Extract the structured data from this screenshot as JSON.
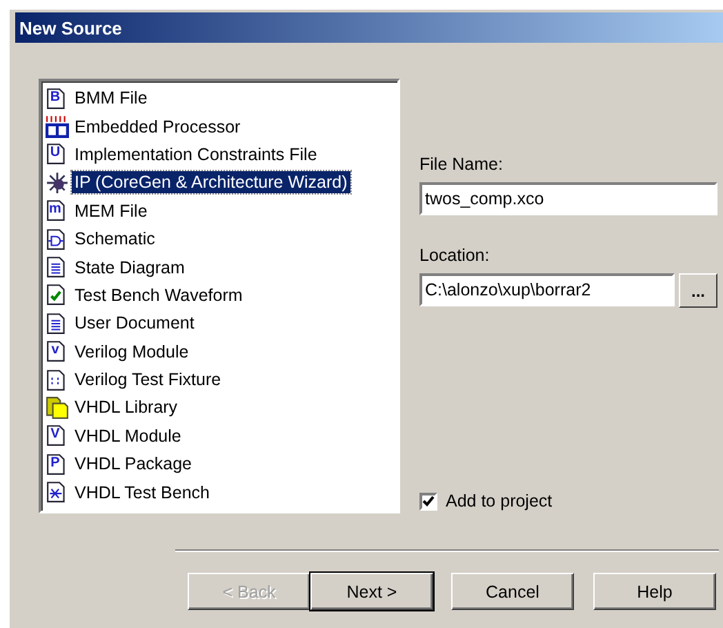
{
  "window": {
    "title": "New Source"
  },
  "source_types": [
    {
      "label": "BMM File",
      "kind": "letter-doc",
      "icon_text": "B",
      "selected": false
    },
    {
      "label": "Embedded Processor",
      "kind": "processor",
      "selected": false
    },
    {
      "label": "Implementation Constraints File",
      "kind": "letter-doc",
      "icon_text": "U",
      "selected": false
    },
    {
      "label": "IP (CoreGen & Architecture Wizard)",
      "kind": "wizard",
      "selected": true
    },
    {
      "label": "MEM File",
      "kind": "letter-doc",
      "icon_text": "m",
      "selected": false
    },
    {
      "label": "Schematic",
      "kind": "schematic",
      "selected": false
    },
    {
      "label": "State Diagram",
      "kind": "lines-doc",
      "selected": false
    },
    {
      "label": "Test Bench Waveform",
      "kind": "check-doc",
      "selected": false
    },
    {
      "label": "User Document",
      "kind": "lines-doc",
      "selected": false
    },
    {
      "label": "Verilog Module",
      "kind": "letter-doc",
      "icon_text": "v",
      "selected": false
    },
    {
      "label": "Verilog Test Fixture",
      "kind": "dots-doc",
      "selected": false
    },
    {
      "label": "VHDL Library",
      "kind": "library",
      "selected": false
    },
    {
      "label": "VHDL Module",
      "kind": "letter-doc",
      "icon_text": "V",
      "selected": false
    },
    {
      "label": "VHDL Package",
      "kind": "letter-doc",
      "icon_text": "P",
      "selected": false
    },
    {
      "label": "VHDL Test Bench",
      "kind": "bench-doc",
      "selected": false
    }
  ],
  "file_name": {
    "label": "File Name:",
    "value": "twos_comp.xco"
  },
  "location": {
    "label": "Location:",
    "value": "C:\\alonzo\\xup\\borrar2",
    "browse_button": "..."
  },
  "add_to_project": {
    "label": "Add to project",
    "checked": true
  },
  "buttons": [
    {
      "label": "< Back",
      "disabled": true,
      "default": false
    },
    {
      "label": "Next >",
      "disabled": false,
      "default": true
    },
    {
      "label": "Cancel",
      "disabled": false,
      "default": false
    },
    {
      "label": "Help",
      "disabled": false,
      "default": false
    }
  ]
}
